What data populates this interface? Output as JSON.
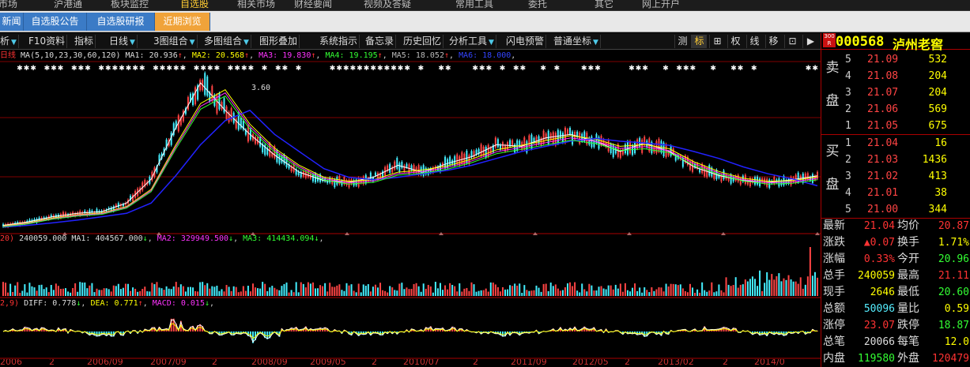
{
  "top_nav": [
    "市场",
    "沪港通",
    "板块监控",
    "自选股",
    "相关市场",
    "财经要闻",
    "视频及答疑",
    "常用工具",
    "委托",
    "其它",
    "网上开户"
  ],
  "top_nav_active": 3,
  "tabs": [
    "新闻",
    "自选股公告",
    "自选股研报",
    "近期浏览"
  ],
  "tabs_active": 3,
  "toolbar_left": [
    {
      "label": "析",
      "arrow": true
    },
    {
      "label": "F10资料",
      "arrow": false
    },
    {
      "label": "指标",
      "arrow": false
    },
    {
      "label": "日线",
      "arrow": true
    },
    {
      "label": "3图组合",
      "arrow": true
    },
    {
      "label": "多图组合",
      "arrow": true
    },
    {
      "label": "图形叠加",
      "arrow": false
    },
    {
      "label": "系统指示",
      "arrow": false
    },
    {
      "label": "备忘录",
      "arrow": false
    },
    {
      "label": "历史回忆",
      "arrow": false
    },
    {
      "label": "分析工具",
      "arrow": true
    },
    {
      "label": "闪电预警",
      "arrow": false
    },
    {
      "label": "普通坐标",
      "arrow": true
    }
  ],
  "toolbar_right": [
    "测",
    "标",
    "⊞",
    "权",
    "线",
    "移",
    "⊡",
    "▶"
  ],
  "toolbar_right_active": 1,
  "ma_legend": {
    "prefix": "日线",
    "ma_label": "MA(5,10,23,30,60,120)",
    "items": [
      {
        "text": "MA1: 20.936",
        "arrow": "↑"
      },
      {
        "text": "MA2: 20.568",
        "arrow": "↑"
      },
      {
        "text": "MA3: 19.830",
        "arrow": "↑"
      },
      {
        "text": "MA4: 19.195",
        "arrow": "↑"
      },
      {
        "text": "MA5: 18.052",
        "arrow": "↑"
      },
      {
        "text": "MA6: 18.000",
        "arrow": ""
      }
    ]
  },
  "peak_label": "3.60",
  "vol_legend": {
    "prefix": "20)",
    "value": "240059.000",
    "items": [
      {
        "text": "MA1: 404567.000",
        "arrow": "↓"
      },
      {
        "text": "MA2: 329949.500",
        "arrow": "↓"
      },
      {
        "text": "MA3: 414434.094",
        "arrow": "↓"
      }
    ]
  },
  "macd_legend": {
    "prefix": "2,9)",
    "items": [
      {
        "text": "DIFF: 0.778",
        "arrow": "↓"
      },
      {
        "text": "DEA: 0.771",
        "arrow": "↑"
      },
      {
        "text": "MACD: 0.015",
        "arrow": "↓"
      }
    ]
  },
  "x_axis_labels": [
    "2006",
    "2",
    "2006/09",
    "2007/09",
    "2",
    "2008/09",
    "2009/05",
    "2",
    "2010/07",
    "2",
    "2011/09",
    "2012/05",
    "2",
    "2013/02",
    "2",
    "2014/0"
  ],
  "stock": {
    "code": "000568",
    "name": "泸州老窖",
    "badge": "300 R"
  },
  "orderbook": {
    "sell_label": [
      "卖",
      "盘"
    ],
    "buy_label": [
      "买",
      "盘"
    ],
    "sell": [
      {
        "level": "5",
        "price": "21.09",
        "vol": "532"
      },
      {
        "level": "4",
        "price": "21.08",
        "vol": "204"
      },
      {
        "level": "3",
        "price": "21.07",
        "vol": "204"
      },
      {
        "level": "2",
        "price": "21.06",
        "vol": "569"
      },
      {
        "level": "1",
        "price": "21.05",
        "vol": "675"
      }
    ],
    "buy": [
      {
        "level": "1",
        "price": "21.04",
        "vol": "16"
      },
      {
        "level": "2",
        "price": "21.03",
        "vol": "1436"
      },
      {
        "level": "3",
        "price": "21.02",
        "vol": "413"
      },
      {
        "level": "4",
        "price": "21.01",
        "vol": "38"
      },
      {
        "level": "5",
        "price": "21.00",
        "vol": "344"
      }
    ]
  },
  "stats": [
    {
      "l1": "最新",
      "v1": "21.04",
      "c1": "red",
      "l2": "均价",
      "v2": "20.87",
      "c2": "red"
    },
    {
      "l1": "涨跌",
      "v1": "▲0.07",
      "c1": "red",
      "l2": "换手",
      "v2": "1.71%",
      "c2": "yel"
    },
    {
      "l1": "涨幅",
      "v1": "0.33%",
      "c1": "red",
      "l2": "今开",
      "v2": "20.96",
      "c2": "grn"
    },
    {
      "l1": "总手",
      "v1": "240059",
      "c1": "yel",
      "l2": "最高",
      "v2": "21.11",
      "c2": "red"
    },
    {
      "l1": "现手",
      "v1": "2646",
      "c1": "yel",
      "l2": "最低",
      "v2": "20.60",
      "c2": "grn"
    },
    {
      "l1": "总额",
      "v1": "50096",
      "c1": "cyan",
      "l2": "量比",
      "v2": "0.59",
      "c2": "yel"
    },
    {
      "l1": "涨停",
      "v1": "23.07",
      "c1": "red",
      "l2": "跌停",
      "v2": "18.87",
      "c2": "grn"
    },
    {
      "l1": "总笔",
      "v1": "20066",
      "c1": "wht",
      "l2": "每笔",
      "v2": "12.0",
      "c2": "yel"
    },
    {
      "l1": "内盘",
      "v1": "119580",
      "c1": "grn",
      "l2": "外盘",
      "v2": "120479",
      "c2": "red"
    }
  ],
  "chart_data": [
    {
      "type": "line",
      "title": "日线",
      "series": [
        {
          "name": "MA1",
          "values": [
            6.5,
            7.5,
            9,
            10,
            10.5,
            13,
            20,
            35,
            48,
            40,
            33,
            27,
            22,
            19.5,
            19,
            20.5,
            24,
            22,
            24.5,
            26.5,
            30,
            29.5,
            32,
            33,
            31,
            28,
            30.5,
            28,
            23.5,
            21,
            19.5,
            19,
            19.8,
            20.9
          ]
        },
        {
          "name": "MA2",
          "values": [
            6.3,
            7.2,
            8.6,
            9.6,
            10.1,
            12,
            17,
            30,
            42,
            46,
            36,
            29,
            24,
            20.5,
            19.3,
            19.8,
            22,
            22.6,
            23.8,
            25.8,
            28.5,
            29.8,
            31.2,
            32.6,
            31.6,
            29.5,
            30,
            28.8,
            25,
            22.2,
            20.2,
            19.3,
            19.5,
            20.6
          ]
        },
        {
          "name": "MA6",
          "values": [
            6,
            6.5,
            7.2,
            8,
            9,
            10,
            13,
            21,
            30,
            37,
            40,
            33,
            28,
            23,
            20.5,
            19.8,
            20.5,
            21.5,
            22.5,
            24,
            26,
            28,
            29.5,
            31,
            31.8,
            31,
            30.5,
            29.8,
            28,
            26,
            23.5,
            21.5,
            20,
            18
          ]
        }
      ],
      "ylabel": "",
      "annotation": "3.60"
    },
    {
      "type": "bar",
      "title": "VOL",
      "series": [
        {
          "name": "VOL",
          "values": [
            240059
          ]
        },
        {
          "name": "MA1",
          "values": [
            404567
          ]
        },
        {
          "name": "MA2",
          "values": [
            329949.5
          ]
        },
        {
          "name": "MA3",
          "values": [
            414434.094
          ]
        }
      ]
    },
    {
      "type": "bar",
      "title": "MACD",
      "series": [
        {
          "name": "DIFF",
          "values": [
            0.778
          ]
        },
        {
          "name": "DEA",
          "values": [
            0.771
          ]
        },
        {
          "name": "MACD",
          "values": [
            0.015
          ]
        }
      ]
    }
  ]
}
